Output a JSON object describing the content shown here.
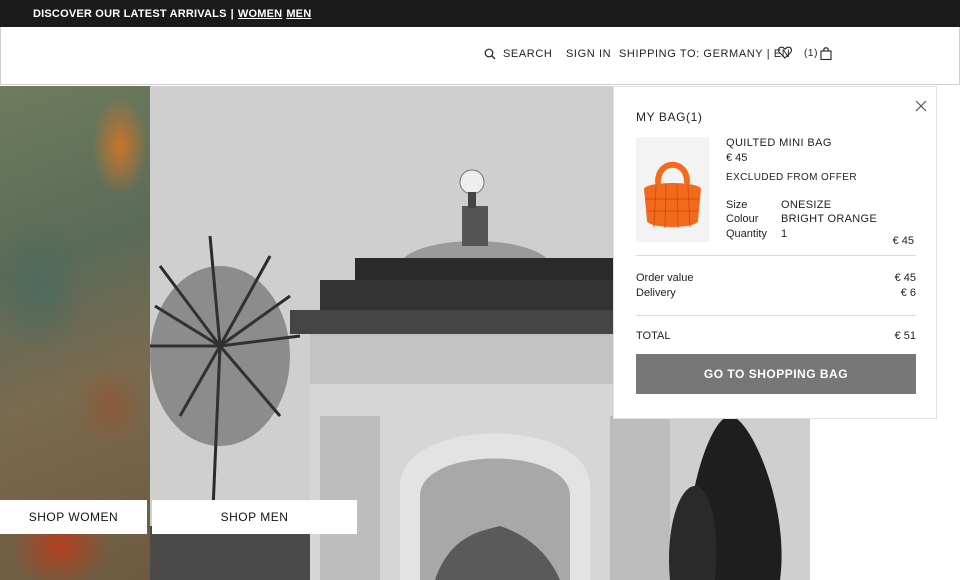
{
  "announcement": {
    "text": "DISCOVER OUR LATEST ARRIVALS",
    "separator": "|",
    "link_women": "WOMEN",
    "link_men": "MEN"
  },
  "header": {
    "search_label": "SEARCH",
    "signin_label": "SIGN IN",
    "shipping_label": "SHIPPING TO: GERMANY | EN",
    "bag_count": "(1)",
    "icons": {
      "search": "search-icon",
      "favourites": "heart-icon",
      "bag": "shopping-bag-icon"
    }
  },
  "hero": {
    "shop_women_label": "SHOP WOMEN",
    "shop_men_label": "SHOP MEN"
  },
  "minibag": {
    "title": "MY BAG(1)",
    "item": {
      "name": "QUILTED MINI BAG",
      "price": "€ 45",
      "offer_note": "EXCLUDED FROM OFFER",
      "size_label": "Size",
      "size_value": "ONESIZE",
      "colour_label": "Colour",
      "colour_value": "BRIGHT ORANGE",
      "quantity_label": "Quantity",
      "quantity_value": "1",
      "line_total": "€ 45"
    },
    "order_value_label": "Order value",
    "order_value": "€ 45",
    "delivery_label": "Delivery",
    "delivery_value": "€ 6",
    "total_label": "TOTAL",
    "total_value": "€ 51",
    "cta_label": "GO TO SHOPPING BAG"
  },
  "colors": {
    "announce_bg": "#1a1a1a",
    "cta_bg": "#777777",
    "bag_orange": "#f26a1b"
  }
}
